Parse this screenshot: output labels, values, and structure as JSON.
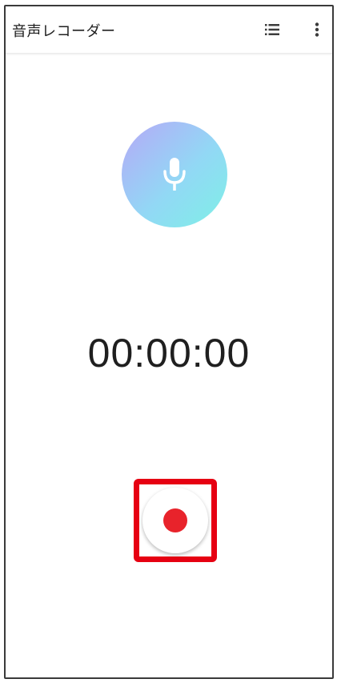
{
  "app_bar": {
    "title": "音声レコーダー",
    "list_icon": "list-icon",
    "more_icon": "more-vert-icon"
  },
  "recorder": {
    "mic_icon": "microphone-icon",
    "elapsed_time": "00:00:00",
    "record_button_icon": "record-dot-icon"
  },
  "colors": {
    "highlight": "#e60012",
    "record_dot": "#e8232b",
    "mic_gradient_start": "#b6a8f7",
    "mic_gradient_end": "#7ef0e6"
  }
}
